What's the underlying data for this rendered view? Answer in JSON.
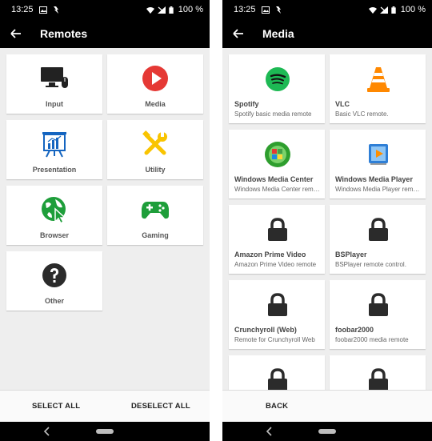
{
  "status": {
    "time": "13:25",
    "battery": "100 %"
  },
  "left": {
    "title": "Remotes",
    "tiles": [
      {
        "label": "Input",
        "icon": "monitor-mouse-icon"
      },
      {
        "label": "Media",
        "icon": "play-icon"
      },
      {
        "label": "Presentation",
        "icon": "presentation-board-icon"
      },
      {
        "label": "Utility",
        "icon": "tools-icon"
      },
      {
        "label": "Browser",
        "icon": "globe-cursor-icon"
      },
      {
        "label": "Gaming",
        "icon": "gamepad-icon"
      },
      {
        "label": "Other",
        "icon": "help-icon"
      }
    ],
    "select_all": "SELECT ALL",
    "deselect_all": "DESELECT ALL"
  },
  "right": {
    "title": "Media",
    "items": [
      {
        "name": "Spotify",
        "desc": "Spotify basic media remote",
        "icon": "spotify-icon"
      },
      {
        "name": "VLC",
        "desc": "Basic VLC remote.",
        "icon": "vlc-cone-icon"
      },
      {
        "name": "Windows Media Center",
        "desc": "Windows Media Center remote",
        "icon": "windows-media-center-icon"
      },
      {
        "name": "Windows Media Player",
        "desc": "Windows Media Player remote",
        "icon": "windows-media-player-icon"
      },
      {
        "name": "Amazon Prime Video",
        "desc": "Amazon Prime Video remote",
        "icon": "lock-icon"
      },
      {
        "name": "BSPlayer",
        "desc": "BSPlayer remote control.",
        "icon": "lock-icon"
      },
      {
        "name": "Crunchyroll (Web)",
        "desc": "Remote for Crunchyroll Web",
        "icon": "lock-icon"
      },
      {
        "name": "foobar2000",
        "desc": "foobar2000 media remote",
        "icon": "lock-icon"
      },
      {
        "name": "",
        "desc": "",
        "icon": "lock-icon"
      },
      {
        "name": "",
        "desc": "",
        "icon": "lock-icon"
      }
    ],
    "back": "BACK"
  },
  "colors": {
    "bar": "#000000",
    "background": "#eeeeee",
    "tile": "#ffffff",
    "media_red": "#e53935",
    "spotify_green": "#1db954",
    "vlc_orange": "#ff8800",
    "utility_yellow": "#f9c400",
    "browser_green": "#1e9e3a",
    "lock_dark": "#2b2b2b"
  }
}
